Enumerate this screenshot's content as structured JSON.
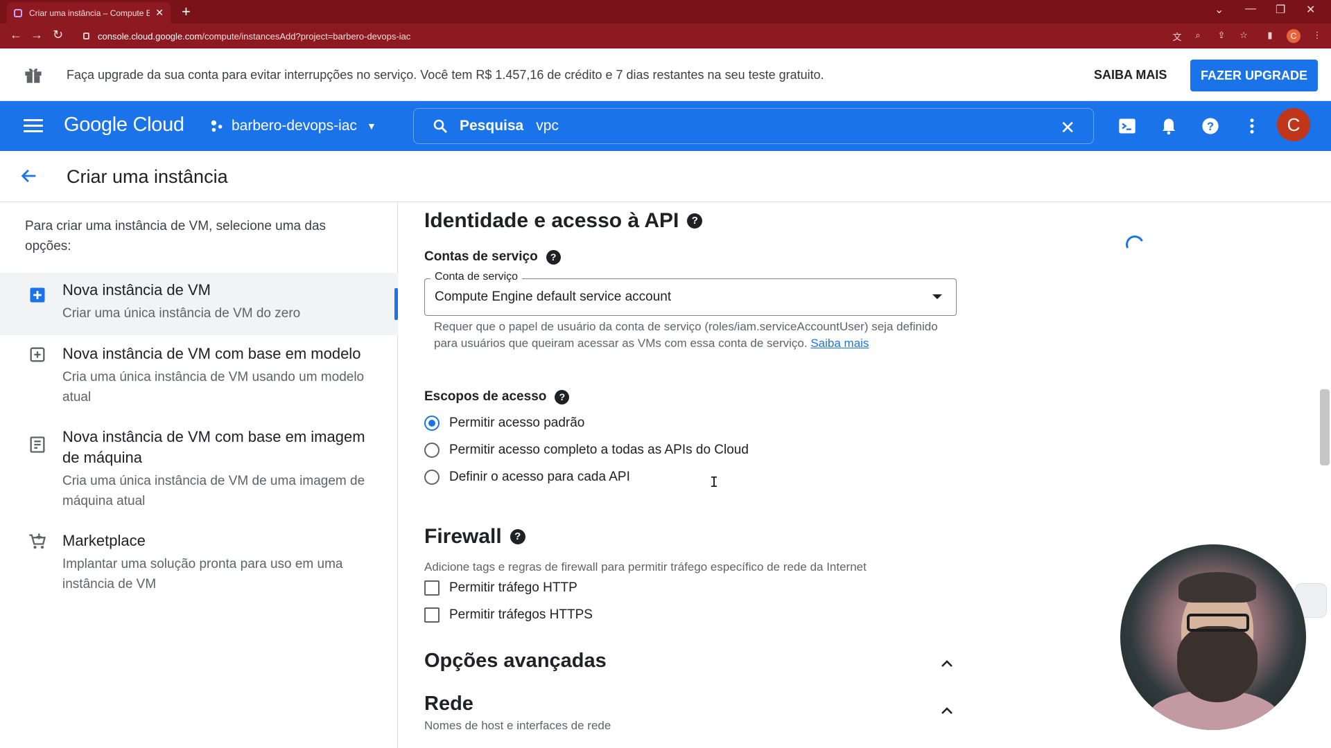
{
  "browser": {
    "tab_title": "Criar uma instância – Compute E",
    "new_tab": "+",
    "url_host": "console.cloud.google.com",
    "url_path": "/compute/instancesAdd?project=barbero-devops-iac",
    "profile_initial": "C"
  },
  "banner": {
    "text": "Faça upgrade da sua conta para evitar interrupções no serviço. Você tem R$ 1.457,16 de crédito e 7 dias restantes na seu teste gratuito.",
    "learn_more": "SAIBA MAIS",
    "upgrade": "FAZER UPGRADE"
  },
  "header": {
    "brand": "Google Cloud",
    "project": "barbero-devops-iac",
    "search_label": "Pesquisa",
    "search_value": "vpc",
    "avatar": "C"
  },
  "page": {
    "title": "Criar uma instância"
  },
  "left": {
    "intro": "Para criar uma instância de VM, selecione uma das opções:",
    "options": [
      {
        "title": "Nova instância de VM",
        "subtitle": "Criar uma única instância de VM do zero"
      },
      {
        "title": "Nova instância de VM com base em modelo",
        "subtitle": "Cria uma única instância de VM usando um modelo atual"
      },
      {
        "title": "Nova instância de VM com base em imagem de máquina",
        "subtitle": "Cria uma única instância de VM de uma imagem de máquina atual"
      },
      {
        "title": "Marketplace",
        "subtitle": "Implantar uma solução pronta para uso em uma instância de VM"
      }
    ]
  },
  "identity": {
    "heading": "Identidade e acesso à API",
    "service_accounts_label": "Contas de serviço",
    "field_label": "Conta de serviço",
    "field_value": "Compute Engine default service account",
    "hint": "Requer que o papel de usuário da conta de serviço (roles/iam.serviceAccountUser) seja definido para usuários que queiram acessar as VMs com essa conta de serviço.",
    "hint_link": "Saiba mais",
    "scopes_label": "Escopos de acesso",
    "scopes": [
      {
        "label": "Permitir acesso padrão",
        "selected": true
      },
      {
        "label": "Permitir acesso completo a todas as APIs do Cloud",
        "selected": false
      },
      {
        "label": "Definir o acesso para cada API",
        "selected": false
      }
    ]
  },
  "firewall": {
    "heading": "Firewall",
    "description": "Adicione tags e regras de firewall para permitir tráfego específico de rede da Internet",
    "http": "Permitir tráfego HTTP",
    "https": "Permitir tráfegos HTTPS"
  },
  "advanced": {
    "heading": "Opções avançadas",
    "network_heading": "Rede",
    "network_desc": "Nomes de host e interfaces de rede"
  },
  "colors": {
    "brand_blue": "#1a73e8",
    "browser_frame": "#7a1319"
  }
}
